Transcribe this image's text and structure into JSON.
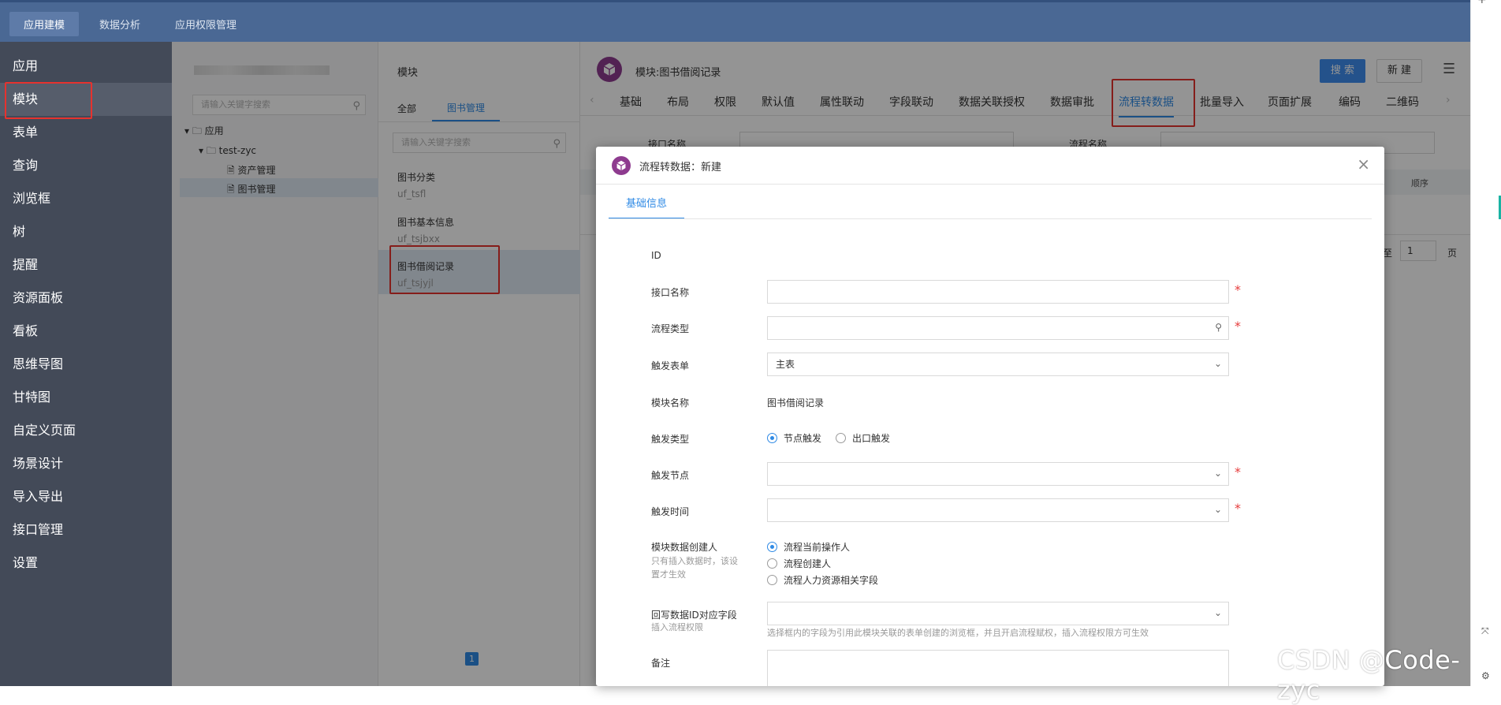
{
  "topnav": [
    "应用建模",
    "数据分析",
    "应用权限管理"
  ],
  "sidebar": [
    "应用",
    "模块",
    "表单",
    "查询",
    "浏览框",
    "树",
    "提醒",
    "资源面板",
    "看板",
    "思维导图",
    "甘特图",
    "自定义页面",
    "场景设计",
    "导入导出",
    "接口管理",
    "设置"
  ],
  "tree": {
    "search_placeholder": "请输入关键字搜索",
    "nodes": [
      "应用",
      "test-zyc",
      "资产管理",
      "图书管理"
    ]
  },
  "modules": {
    "title": "模块",
    "tabs": [
      "全部",
      "图书管理"
    ],
    "search_placeholder": "请输入关键字搜索",
    "items": [
      {
        "name": "图书分类",
        "code": "uf_tsfl"
      },
      {
        "name": "图书基本信息",
        "code": "uf_tsjbxx"
      },
      {
        "name": "图书借阅记录",
        "code": "uf_tsjyjl"
      }
    ],
    "page": "1"
  },
  "main": {
    "title": "模块:图书借阅记录",
    "search_button": "搜 索",
    "new_button": "新 建",
    "tabs": [
      "基础",
      "布局",
      "权限",
      "默认值",
      "属性联动",
      "字段联动",
      "数据关联授权",
      "数据审批",
      "流程转数据",
      "批量导入",
      "页面扩展",
      "编码",
      "二维码"
    ],
    "filter_label_1": "接口名称",
    "filter_label_2": "流程名称",
    "col_order": "顺序",
    "pager_to": "至",
    "pager_page": "1",
    "pager_suffix": "页"
  },
  "modal": {
    "title": "流程转数据：新建",
    "tab": "基础信息",
    "fields": {
      "id_label": "ID",
      "api_name_label": "接口名称",
      "flow_type_label": "流程类型",
      "trigger_form_label": "触发表单",
      "trigger_form_value": "主表",
      "module_name_label": "模块名称",
      "module_name_value": "图书借阅记录",
      "trigger_type_label": "触发类型",
      "trigger_type_options": [
        "节点触发",
        "出口触发"
      ],
      "trigger_node_label": "触发节点",
      "trigger_time_label": "触发时间",
      "creator_label": "模块数据创建人",
      "creator_sub": "只有插入数据时，该设置才生效",
      "creator_options": [
        "流程当前操作人",
        "流程创建人",
        "流程人力资源相关字段"
      ],
      "writeback_label": "回写数据ID对应字段",
      "writeback_sub": "插入流程权限",
      "writeback_hint": "选择框内的字段为引用此模块关联的表单创建的浏览框，并且开启流程赋权，插入流程权限方可生效",
      "remark_label": "备注"
    }
  },
  "watermark": "CSDN @Code-zyc",
  "colors": {
    "topbar": "#4a6894",
    "sidebar": "#434a58",
    "accent": "#2f8ae5",
    "highlight": "#e6322e"
  }
}
